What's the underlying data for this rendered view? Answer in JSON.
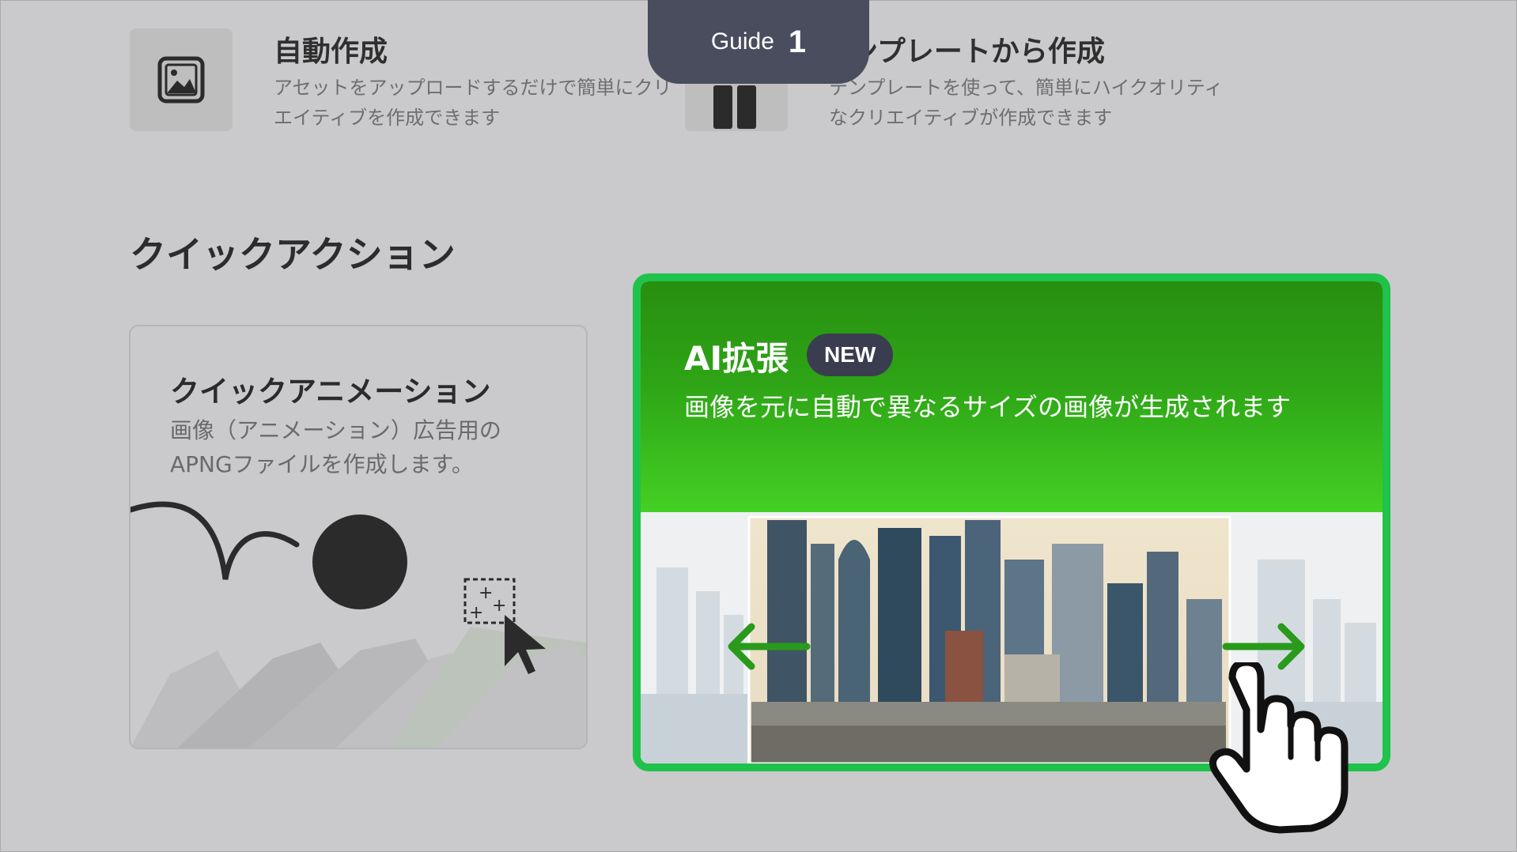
{
  "guide": {
    "label": "Guide",
    "number": "1"
  },
  "auto_create": {
    "title": "自動作成",
    "description": "アセットをアップロードするだけで簡単にクリエイティブを作成できます",
    "icon": "image-icon"
  },
  "template_create": {
    "title": "テンプレートから作成",
    "visible_title": "ンプレートから作成",
    "description": "テンプレートを使って、簡単にハイクオリティなクリエイティブが作成できます",
    "icon": "grid-icon"
  },
  "quick_actions": {
    "heading": "クイックアクション",
    "animation_card": {
      "title": "クイックアニメーション",
      "description": "画像（アニメーション）広告用のAPNGファイルを作成します。",
      "illustration": "animation-illustration"
    },
    "ai_card": {
      "title": "AI拡張",
      "badge": "NEW",
      "description": "画像を元に自動で異なるサイズの画像が生成されます",
      "image": "city-skyline-image",
      "accent": "#1fc24a"
    }
  },
  "colors": {
    "background": "#cacacc",
    "guide_tab": "#4a4d5e",
    "card_gradient_top": "#288f10",
    "card_gradient_bottom": "#44d024",
    "arrow": "#2a9a1c"
  }
}
